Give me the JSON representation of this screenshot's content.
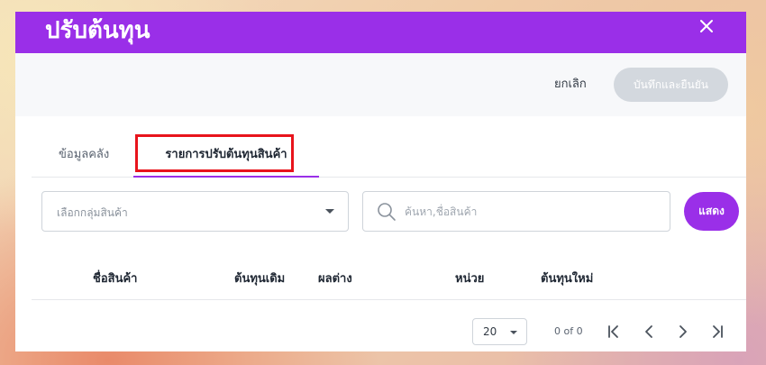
{
  "dialog": {
    "title": "ปรับต้นทุน",
    "close_icon": "close-icon"
  },
  "actions": {
    "cancel_label": "ยกเลิก",
    "save_label": "บันทึกและยืนยัน"
  },
  "tabs": [
    {
      "label": "ข้อมูลคลัง",
      "active": false
    },
    {
      "label": "รายการปรับต้นทุนสินค้า",
      "active": true
    }
  ],
  "filters": {
    "group_placeholder": "เลือกกลุ่มสินค้า",
    "search_placeholder": "ค้นหา,ชื่อสินค้า",
    "show_label": "แสดง"
  },
  "table": {
    "columns": [
      "ชื่อสินค้า",
      "ต้นทุนเดิม",
      "ผลต่าง",
      "หน่วย",
      "ต้นทุนใหม่"
    ],
    "rows": []
  },
  "pagination": {
    "page_size": "20",
    "info": "0 of 0"
  },
  "colors": {
    "accent": "#9a2fe8",
    "highlight": "#e8141c",
    "disabled_button": "#d3d8de"
  }
}
